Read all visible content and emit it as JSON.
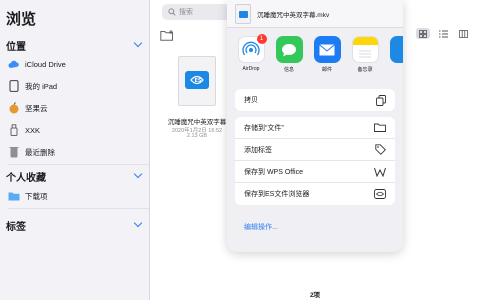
{
  "sidebar": {
    "title": "浏览",
    "locations_header": "位置",
    "locations": [
      {
        "label": "iCloud Drive",
        "icon": "cloud-icon"
      },
      {
        "label": "我的 iPad",
        "icon": "ipad-icon"
      },
      {
        "label": "坚果云",
        "icon": "nutstore-icon"
      },
      {
        "label": "XXK",
        "icon": "usb-drive-icon"
      },
      {
        "label": "最近删除",
        "icon": "trash-icon"
      }
    ],
    "favorites_header": "个人收藏",
    "favorites": [
      {
        "label": "下载项",
        "icon": "folder-icon"
      }
    ],
    "tags_header": "标签"
  },
  "main": {
    "search_placeholder": "搜索",
    "file": {
      "name": "沉睡魔咒中英双字幕",
      "date": "2020年1月2日 16:52",
      "size": "2.13 GB"
    },
    "item_count": "2项"
  },
  "share": {
    "filename": "沉睡魔咒中英双字幕.mkv",
    "apps": [
      {
        "label": "AirDrop",
        "color": "#ffffff",
        "icon": "airdrop-icon",
        "badge": "1"
      },
      {
        "label": "信息",
        "color": "#34c759",
        "icon": "messages-icon"
      },
      {
        "label": "邮件",
        "color": "#1e7cf2",
        "icon": "mail-icon"
      },
      {
        "label": "备忘录",
        "color": "#ffd60a",
        "icon": "notes-icon"
      }
    ],
    "copy_label": "拷贝",
    "actions": [
      {
        "label": "存储到“文件”",
        "icon": "folder-icon"
      },
      {
        "label": "添加标签",
        "icon": "tag-icon"
      },
      {
        "label": "保存到 WPS Office",
        "icon": "wps-icon"
      },
      {
        "label": "保存到ES文件浏览器",
        "icon": "es-explorer-icon"
      }
    ],
    "edit_actions": "编辑操作..."
  },
  "colors": {
    "accent": "#2f7ef0",
    "sidebar_bg": "#f2f2f7",
    "sheet_bg": "#efeff4"
  }
}
